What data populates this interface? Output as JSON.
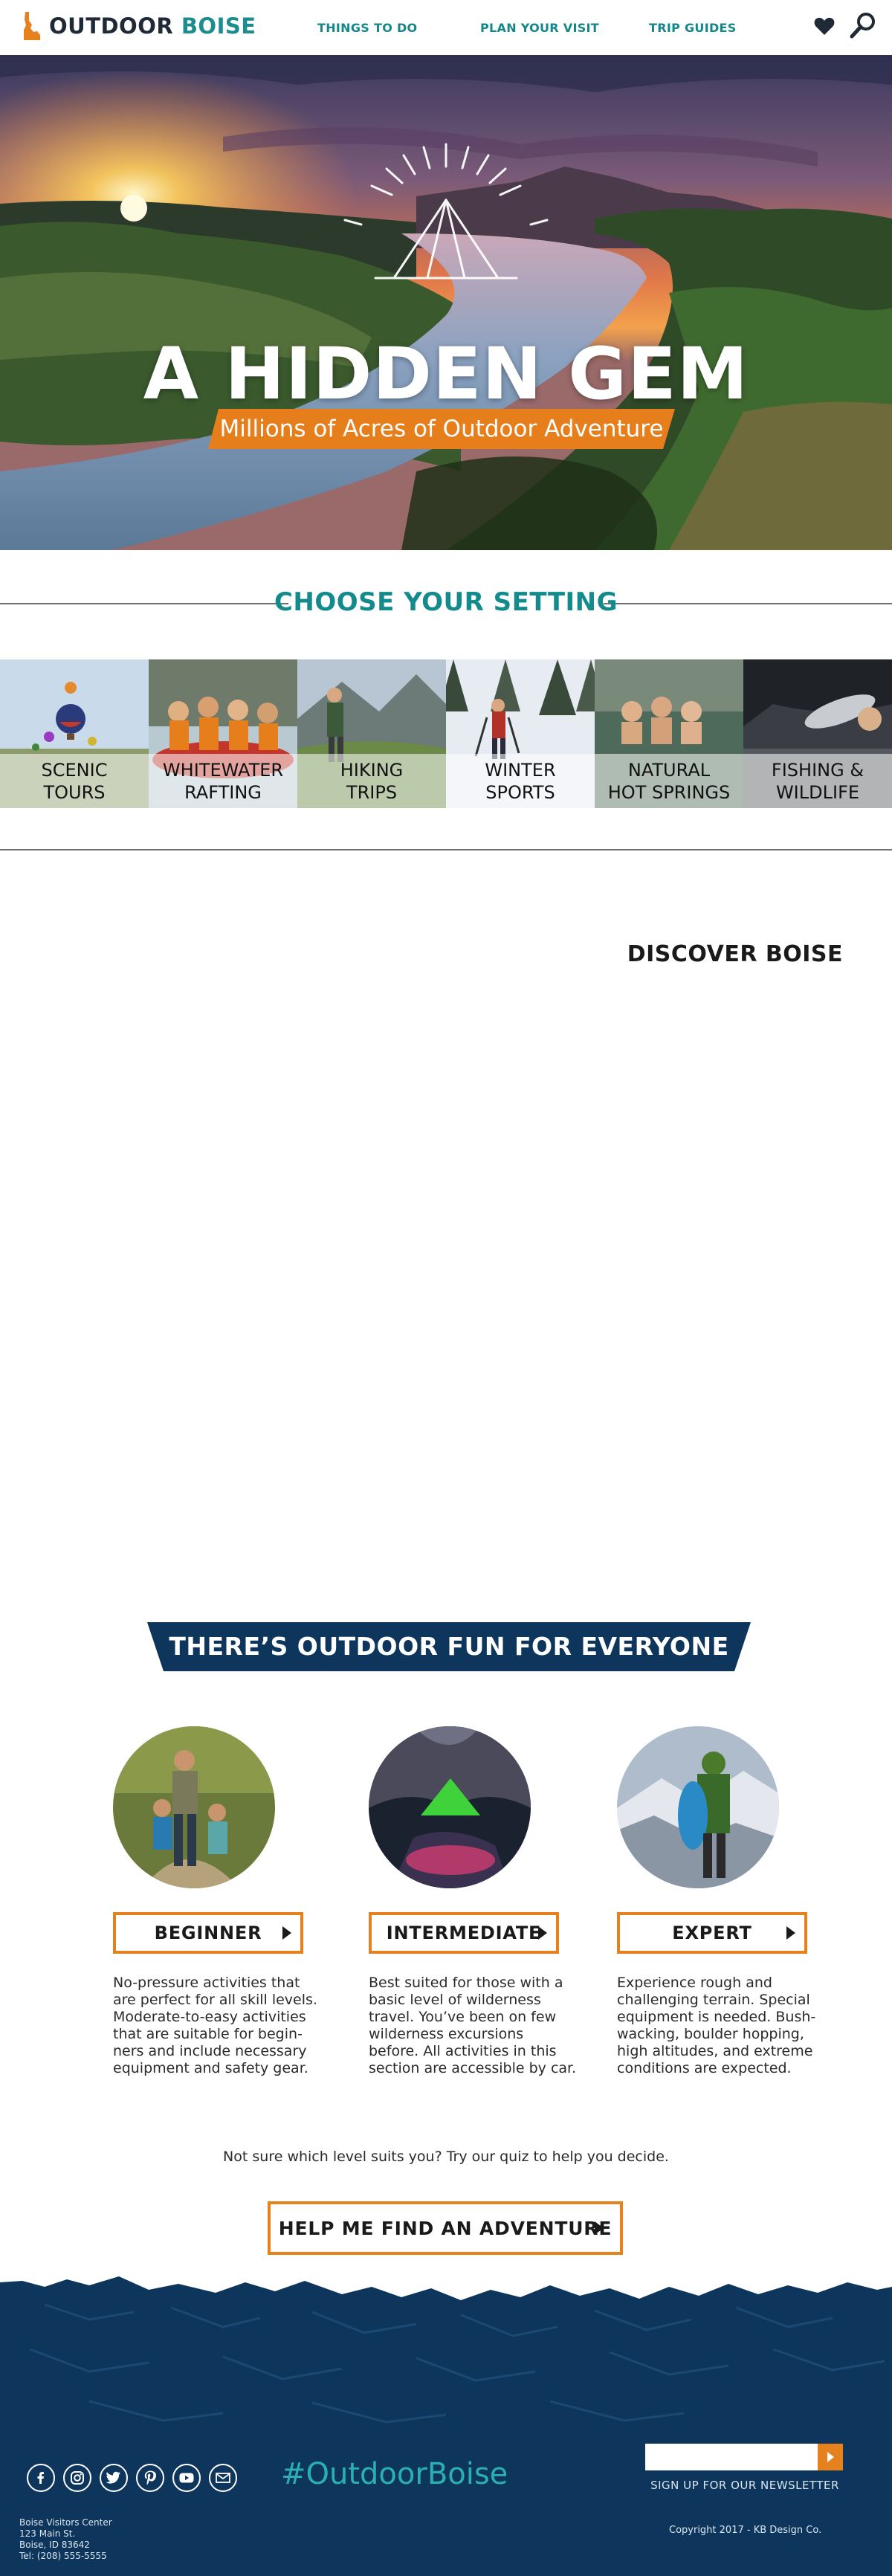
{
  "header": {
    "logo_word1": "OUTDOOR",
    "logo_word2": "BOISE",
    "nav": [
      {
        "label": "THINGS TO DO"
      },
      {
        "label": "PLAN YOUR VISIT"
      },
      {
        "label": "TRIP GUIDES"
      }
    ],
    "icons": [
      "heart-icon",
      "search-icon"
    ]
  },
  "hero": {
    "title": "A HIDDEN GEM",
    "subtitle": "Millions of Acres of Outdoor Adventure"
  },
  "setting": {
    "title": "CHOOSE YOUR SETTING",
    "tiles": [
      {
        "label": "SCENIC\nTOURS"
      },
      {
        "label": "WHITEWATER\nRAFTING"
      },
      {
        "label": "HIKING\nTRIPS"
      },
      {
        "label": "WINTER\nSPORTS"
      },
      {
        "label": "NATURAL\nHOT SPRINGS"
      },
      {
        "label": "FISHING &\nWILDLIFE"
      }
    ]
  },
  "discover": {
    "title": "DISCOVER BOISE"
  },
  "levels": {
    "banner": "THERE’S OUTDOOR FUN FOR EVERYONE",
    "items": [
      {
        "label": "BEGINNER",
        "description": "No-pressure activities that are perfect for all skill levels. Moderate-to-easy activities that are suitable for begin-ners and include necessary equipment and safety gear."
      },
      {
        "label": "INTERMEDIATE",
        "description": "Best suited for those with a basic level of wilderness travel. You’ve been on few wilderness excursions before. All activities in this section are accessible by car."
      },
      {
        "label": "EXPERT",
        "description": "Experience rough and challenging terrain. Special equipment is needed. Bush-wacking, boulder hopping, high altitudes, and extreme conditions are expected."
      }
    ],
    "quiz_text": "Not sure which level suits you? Try our quiz to help you decide.",
    "cta_label": "HELP ME FIND AN ADVENTURE"
  },
  "footer": {
    "social": [
      "facebook-icon",
      "instagram-icon",
      "twitter-icon",
      "pinterest-icon",
      "youtube-icon",
      "email-icon"
    ],
    "hashtag": "#OutdoorBoise",
    "newsletter_placeholder": "",
    "newsletter_label": "SIGN UP FOR OUR NEWSLETTER",
    "address": {
      "name": "Boise Visitors Center",
      "street": "123 Main St.",
      "city": "Boise, ID 83642",
      "phone": "Tel: (208) 555-5555"
    },
    "copyright": "Copyright 2017 - KB Design Co."
  },
  "colors": {
    "teal": "#138b8d",
    "orange": "#e6821e",
    "navy": "#0e365c",
    "dark": "#1f2a36"
  }
}
